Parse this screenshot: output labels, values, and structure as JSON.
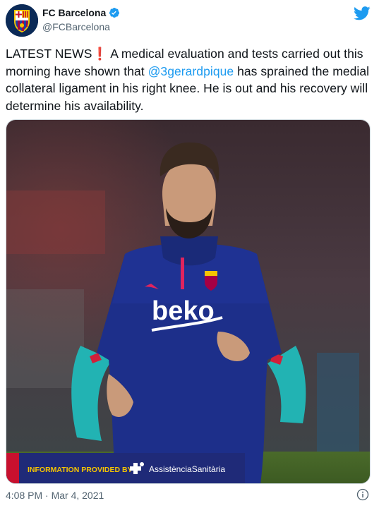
{
  "account": {
    "display_name": "FC Barcelona",
    "handle": "@FCBarcelona",
    "verified": true
  },
  "tweet": {
    "text_prefix": "LATEST NEWS",
    "emoji": "❗",
    "text_part1": " A medical evaluation and tests carried out this morning have shown that ",
    "mention": "@3gerardpique",
    "text_part2": " has sprained the medial collateral ligament in his right knee. He is out and his recovery will determine his availability."
  },
  "media": {
    "jersey_sponsor": "beko",
    "banner_label": "INFORMATION PROVIDED BY",
    "banner_sponsor": "AssistènciaSanitària"
  },
  "meta": {
    "timestamp": "4:08 PM · Mar 4, 2021"
  },
  "colors": {
    "brand_blue": "#1d9bf0",
    "banner_navy": "#1f2a78",
    "banner_red": "#c8102e",
    "banner_yellow": "#f6c400"
  },
  "icons": [
    "club-crest-icon",
    "verified-badge-icon",
    "twitter-bird-icon",
    "info-icon"
  ]
}
